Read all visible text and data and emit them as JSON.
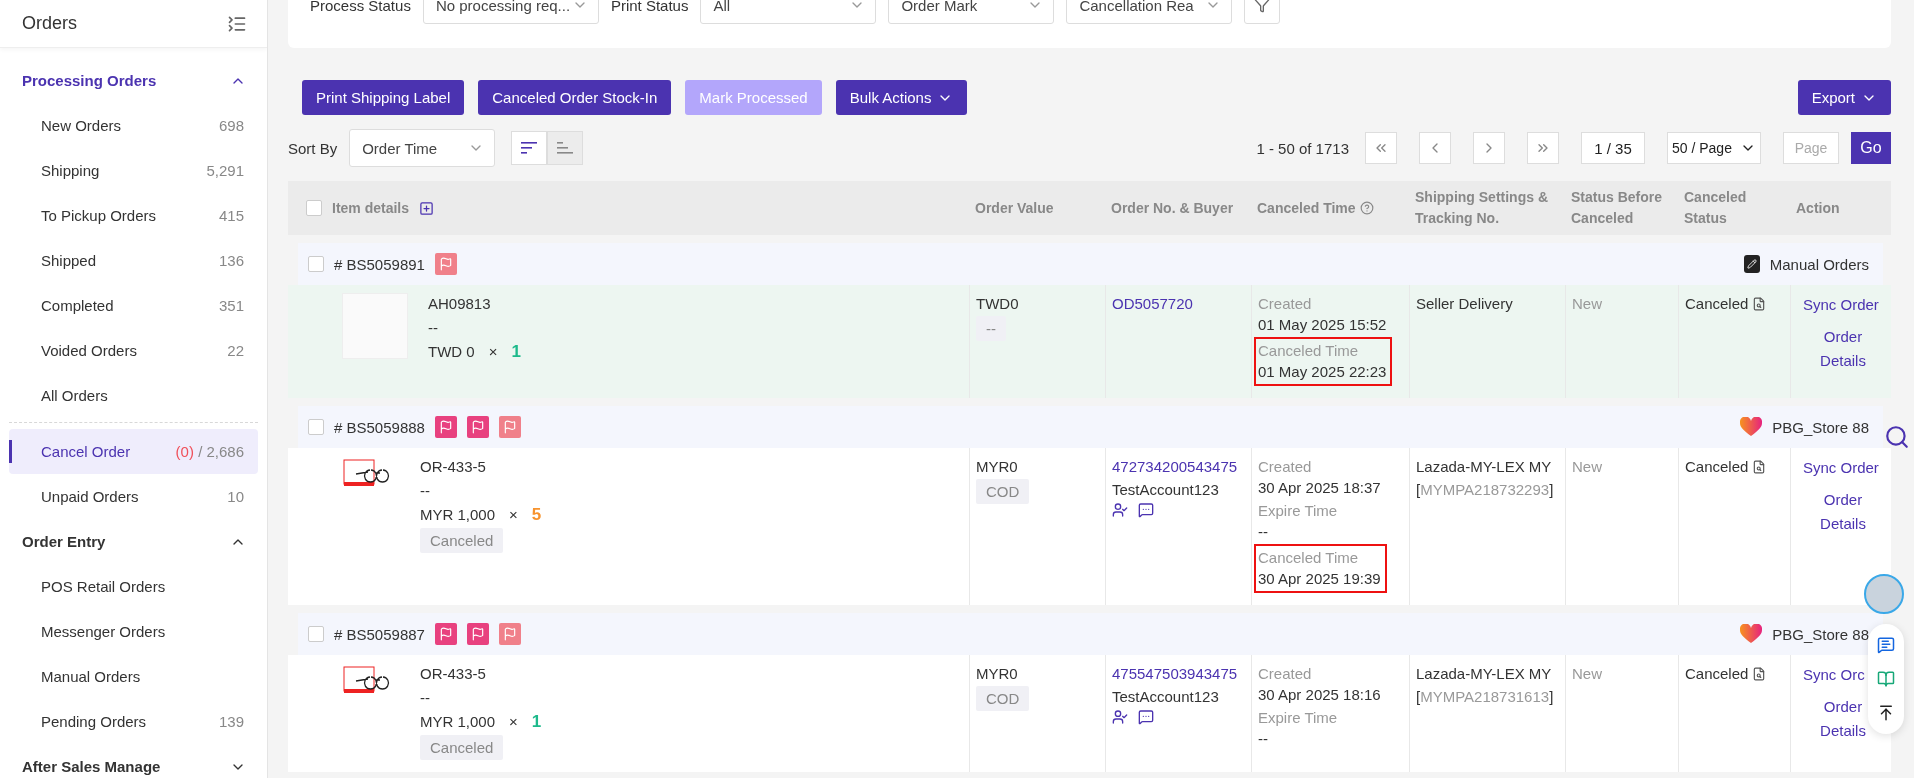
{
  "sidebar": {
    "title": "Orders",
    "sections": [
      {
        "label": "Processing Orders",
        "selected": true,
        "expanded": true,
        "items": [
          {
            "label": "New Orders",
            "count": "698",
            "selected": false,
            "divider_before": false
          },
          {
            "label": "Shipping",
            "count": "5,291",
            "selected": false,
            "divider_before": false
          },
          {
            "label": "To Pickup Orders",
            "count": "415",
            "selected": false,
            "divider_before": false
          },
          {
            "label": "Shipped",
            "count": "136",
            "selected": false,
            "divider_before": false
          },
          {
            "label": "Completed",
            "count": "351",
            "selected": false,
            "divider_before": false
          },
          {
            "label": "Voided Orders",
            "count": "22",
            "selected": false,
            "divider_before": false
          },
          {
            "label": "All Orders",
            "selected": false,
            "divider_before": false
          },
          {
            "label": "Cancel Order",
            "alert_count": "(0)",
            "count": "/ 2,686",
            "selected": true,
            "divider_before": true
          },
          {
            "label": "Unpaid Orders",
            "count": "10",
            "selected": false,
            "divider_before": false
          }
        ]
      },
      {
        "label": "Order Entry",
        "selected": false,
        "expanded": true,
        "items": [
          {
            "label": "POS Retail Orders",
            "selected": false,
            "divider_before": false
          },
          {
            "label": "Messenger Orders",
            "selected": false,
            "divider_before": false
          },
          {
            "label": "Manual Orders",
            "selected": false,
            "divider_before": false
          },
          {
            "label": "Pending Orders",
            "count": "139",
            "selected": false,
            "divider_before": false
          }
        ]
      },
      {
        "label": "After Sales Manage",
        "selected": false,
        "expanded": false
      }
    ]
  },
  "filters": [
    {
      "label": "Process Status",
      "value": "No processing req..."
    },
    {
      "label": "Print Status",
      "value": "All"
    },
    {
      "value": "Order Mark"
    },
    {
      "value": "Cancellation Rea"
    }
  ],
  "actions": [
    {
      "label": "Print Shipping Label",
      "disabled": false,
      "dropdown": false
    },
    {
      "label": "Canceled Order Stock-In",
      "disabled": false,
      "dropdown": false
    },
    {
      "label": "Mark Processed",
      "disabled": true,
      "dropdown": false
    },
    {
      "label": "Bulk Actions",
      "disabled": false,
      "dropdown": true
    }
  ],
  "export": {
    "label": "Export"
  },
  "sort": {
    "label": "Sort By",
    "value": "Order Time",
    "directions": [
      {
        "kind": "desc",
        "selected": true
      },
      {
        "kind": "asc",
        "selected": false
      }
    ]
  },
  "pagination": {
    "range": "1 - 50 of 1713",
    "page": "1 / 35",
    "per_page": "50 / Page",
    "page_placeholder": "Page",
    "go": "Go"
  },
  "table": {
    "checked": false,
    "columns": [
      "Item details",
      "Order Value",
      "Order No. & Buyer",
      "Canceled Time",
      "Shipping Settings & Tracking No.",
      "Status Before Canceled",
      "Canceled Status",
      "Action"
    ],
    "orders": [
      {
        "number": "# BS5059891",
        "checked": false,
        "hovered": true,
        "flags": [
          {
            "color": "#f0808a"
          }
        ],
        "source": {
          "kind": "manual",
          "name": "Manual Orders"
        },
        "item": {
          "kind": "placeholder",
          "sku": "AH09813",
          "variant": "--",
          "price": "TWD 0",
          "times": "×",
          "qty": "1",
          "color": "#1db98b"
        },
        "order_value": {
          "amount": "TWD0",
          "tag": "--"
        },
        "order_no": "OD5057720",
        "times": [
          {
            "label": "Created",
            "value": "01 May 2025 15:52",
            "highlighted": false
          },
          {
            "label": "Canceled Time",
            "value": "01 May 2025 22:23",
            "highlighted": true
          }
        ],
        "shipping": {
          "method": "Seller Delivery"
        },
        "status_before": "New",
        "canceled_status": "Canceled",
        "links": [
          "Sync Order",
          "Order Details"
        ]
      },
      {
        "number": "# BS5059888",
        "checked": false,
        "hovered": false,
        "flags": [
          {
            "color": "#e8417f"
          },
          {
            "color": "#e8417f"
          },
          {
            "color": "#f0808a"
          }
        ],
        "source": {
          "kind": "lazada",
          "name": "PBG_Store 88"
        },
        "item": {
          "kind": "photo",
          "sku": "OR-433-5",
          "variant": "--",
          "price": "MYR 1,000",
          "times": "×",
          "qty": "5",
          "color": "#f7932e",
          "tag": "Canceled"
        },
        "order_value": {
          "amount": "MYR0",
          "tag": "COD"
        },
        "order_no": "472734200543475",
        "buyer": "TestAccount123",
        "times": [
          {
            "label": "Created",
            "value": "30 Apr 2025 18:37",
            "highlighted": false
          },
          {
            "label": "Expire Time",
            "value": "--",
            "highlighted": false
          },
          {
            "label": "Canceled Time",
            "value": "30 Apr 2025 19:39",
            "highlighted": true
          }
        ],
        "shipping": {
          "method": "Lazada-MY-LEX MY",
          "open": "[",
          "tracking": "MYMPA218732293",
          "close": "]"
        },
        "status_before": "New",
        "canceled_status": "Canceled",
        "links": [
          "Sync Order",
          "Order Details"
        ]
      },
      {
        "number": "# BS5059887",
        "checked": false,
        "hovered": false,
        "flags": [
          {
            "color": "#e8417f"
          },
          {
            "color": "#e8417f"
          },
          {
            "color": "#f0808a"
          }
        ],
        "source": {
          "kind": "lazada",
          "name": "PBG_Store 88"
        },
        "item": {
          "kind": "photo",
          "sku": "OR-433-5",
          "variant": "--",
          "price": "MYR 1,000",
          "times": "×",
          "qty": "1",
          "color": "#1db98b",
          "tag": "Canceled"
        },
        "order_value": {
          "amount": "MYR0",
          "tag": "COD"
        },
        "order_no": "475547503943475",
        "buyer": "TestAccount123",
        "times": [
          {
            "label": "Created",
            "value": "30 Apr 2025 18:16",
            "highlighted": false
          },
          {
            "label": "Expire Time",
            "value": "--",
            "highlighted": false
          }
        ],
        "shipping": {
          "method": "Lazada-MY-LEX MY",
          "open": "[",
          "tracking": "MYMPA218731613",
          "close": "]"
        },
        "status_before": "New",
        "canceled_status": "Canceled",
        "links": [
          "Sync Orc",
          "Order Details"
        ]
      }
    ]
  }
}
